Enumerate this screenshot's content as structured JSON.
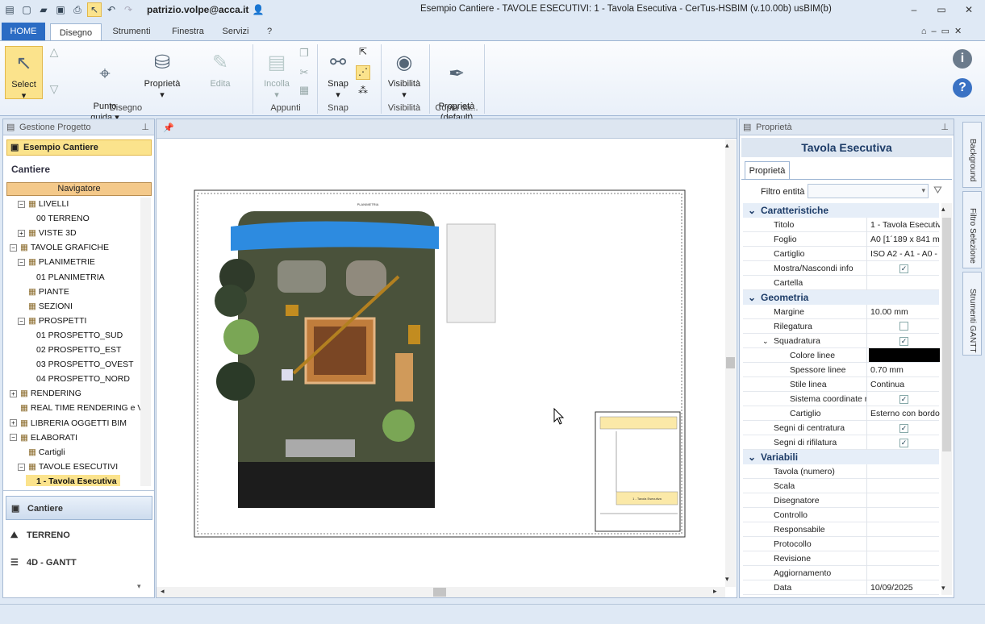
{
  "titlebar": {
    "user": "patrizio.volpe@acca.it",
    "title": "Esempio Cantiere -  TAVOLE ESECUTIVI: 1 - Tavola Esecutiva - CerTus-HSBIM (v.10.00b) usBIM(b)",
    "minimize": "–",
    "restore": "▭",
    "close": "✕"
  },
  "tabs": [
    "HOME",
    "Disegno",
    "Strumenti",
    "Finestra",
    "Servizi",
    "?"
  ],
  "ribbon": {
    "select": "Select",
    "punto_guida": "Punto\nguida",
    "proprieta": "Proprietà",
    "edita": "Edita",
    "incolla": "Incolla",
    "snap": "Snap",
    "visibilita": "Visibilità",
    "proprieta_default": "Proprietà\n(default)",
    "groups": {
      "disegno": "Disegno",
      "appunti": "Appunti",
      "snap": "Snap",
      "visibilita": "Visibilità",
      "copia": "Copia da..."
    }
  },
  "left": {
    "header": "Gestione Progetto",
    "project": "Esempio Cantiere",
    "section": "Cantiere",
    "navigator": "Navigatore",
    "tree": [
      {
        "label": "LIVELLI",
        "indent": 2,
        "exp": "−"
      },
      {
        "label": "00 TERRENO",
        "indent": 4,
        "exp": ""
      },
      {
        "label": "VISTE 3D",
        "indent": 2,
        "exp": "+"
      },
      {
        "label": "TAVOLE GRAFICHE",
        "indent": 0,
        "exp": "−"
      },
      {
        "label": "PLANIMETRIE",
        "indent": 2,
        "exp": "−"
      },
      {
        "label": "01 PLANIMETRIA",
        "indent": 4,
        "exp": ""
      },
      {
        "label": "PIANTE",
        "indent": 2,
        "exp": ""
      },
      {
        "label": "SEZIONI",
        "indent": 2,
        "exp": ""
      },
      {
        "label": "PROSPETTI",
        "indent": 2,
        "exp": "−"
      },
      {
        "label": "01 PROSPETTO_SUD",
        "indent": 4,
        "exp": ""
      },
      {
        "label": "02 PROSPETTO_EST",
        "indent": 4,
        "exp": ""
      },
      {
        "label": "03 PROSPETTO_OVEST",
        "indent": 4,
        "exp": ""
      },
      {
        "label": "04 PROSPETTO_NORD",
        "indent": 4,
        "exp": ""
      },
      {
        "label": "RENDERING",
        "indent": 0,
        "exp": "+"
      },
      {
        "label": "REAL TIME RENDERING e VR",
        "indent": 0,
        "exp": ""
      },
      {
        "label": "LIBRERIA OGGETTI BIM",
        "indent": 0,
        "exp": "+"
      },
      {
        "label": "ELABORATI",
        "indent": 0,
        "exp": "−"
      },
      {
        "label": "Cartigli",
        "indent": 2,
        "exp": ""
      },
      {
        "label": "TAVOLE ESECUTIVI",
        "indent": 2,
        "exp": "−"
      },
      {
        "label": "1 - Tavola Esecutiva",
        "indent": 4,
        "exp": ""
      }
    ],
    "bottom": [
      "Cantiere",
      "TERRENO",
      "4D - GANTT"
    ]
  },
  "canvas": {
    "sheet_title": "PLANIMETRIA",
    "cartiglio_title": "1 - Tavola Esecutiva"
  },
  "right": {
    "header": "Proprietà",
    "title": "Tavola Esecutiva",
    "tab": "Proprietà",
    "filter_label": "Filtro entità",
    "categories": {
      "caratteristiche": "Caratteristiche",
      "geometria": "Geometria",
      "variabili": "Variabili"
    },
    "rows": [
      {
        "k": "Titolo",
        "v": "1 - Tavola Esecutiv"
      },
      {
        "k": "Foglio",
        "v": "A0 [1´189 x 841 m"
      },
      {
        "k": "Cartiglio",
        "v": "ISO  A2 - A1 - A0 -"
      },
      {
        "k": "Mostra/Nascondi info",
        "v": "✓"
      },
      {
        "k": "Cartella",
        "v": ""
      },
      {
        "k": "Margine",
        "v": "10.00 mm"
      },
      {
        "k": "Rilegatura",
        "v": ""
      },
      {
        "k": "Squadratura",
        "v": "✓"
      },
      {
        "k": "Colore linee",
        "v": ""
      },
      {
        "k": "Spessore linee",
        "v": "0.70 mm"
      },
      {
        "k": "Stile linea",
        "v": "Continua"
      },
      {
        "k": "Sistema coordinate ri",
        "v": "✓"
      },
      {
        "k": "Cartiglio",
        "v": "Esterno con bordo"
      },
      {
        "k": "Segni di centratura",
        "v": "✓"
      },
      {
        "k": "Segni di rifilatura",
        "v": "✓"
      },
      {
        "k": "Tavola (numero)",
        "v": ""
      },
      {
        "k": "Scala",
        "v": ""
      },
      {
        "k": "Disegnatore",
        "v": ""
      },
      {
        "k": "Controllo",
        "v": ""
      },
      {
        "k": "Responsabile",
        "v": ""
      },
      {
        "k": "Protocollo",
        "v": ""
      },
      {
        "k": "Revisione",
        "v": ""
      },
      {
        "k": "Aggiornamento",
        "v": ""
      },
      {
        "k": "Data",
        "v": "10/09/2025"
      }
    ]
  },
  "sidebar": [
    "Background",
    "Filtro Selezione",
    "Strumenti GANTT"
  ],
  "colors": {
    "accent": "#2b6cc4",
    "highlight": "#fbe38c",
    "navigator": "#f4c98a"
  }
}
